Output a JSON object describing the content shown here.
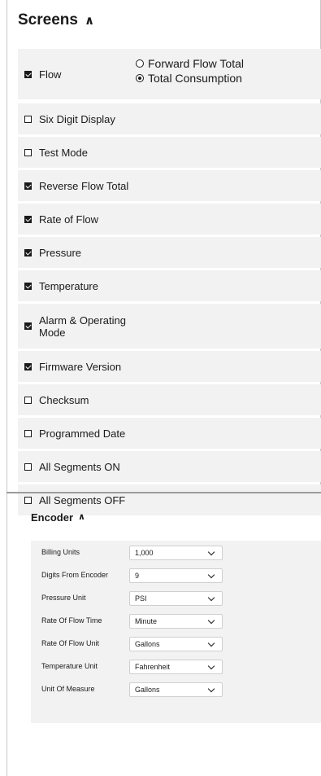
{
  "screens": {
    "title": "Screens",
    "items": [
      {
        "label": "Flow",
        "checked": true
      },
      {
        "label": "Six Digit Display",
        "checked": false
      },
      {
        "label": "Test Mode",
        "checked": false
      },
      {
        "label": "Reverse Flow Total",
        "checked": true
      },
      {
        "label": "Rate of Flow",
        "checked": true
      },
      {
        "label": "Pressure",
        "checked": true
      },
      {
        "label": "Temperature",
        "checked": true
      },
      {
        "label": "Alarm & Operating Mode",
        "checked": true
      },
      {
        "label": "Firmware Version",
        "checked": true
      },
      {
        "label": "Checksum",
        "checked": false
      },
      {
        "label": "Programmed Date",
        "checked": false
      },
      {
        "label": "All Segments ON",
        "checked": false
      },
      {
        "label": "All Segments OFF",
        "checked": false
      }
    ],
    "flow_options": [
      {
        "label": "Forward Flow Total",
        "selected": false
      },
      {
        "label": "Total Consumption",
        "selected": true
      }
    ]
  },
  "encoder": {
    "title": "Encoder",
    "fields": [
      {
        "label": "Billing Units",
        "value": "1,000"
      },
      {
        "label": "Digits From Encoder",
        "value": "9"
      },
      {
        "label": "Pressure Unit",
        "value": "PSI"
      },
      {
        "label": "Rate Of Flow Time",
        "value": "Minute"
      },
      {
        "label": "Rate Of Flow Unit",
        "value": "Gallons"
      },
      {
        "label": "Temperature Unit",
        "value": "Fahrenheit"
      },
      {
        "label": "Unit Of Measure",
        "value": "Gallons"
      }
    ]
  }
}
